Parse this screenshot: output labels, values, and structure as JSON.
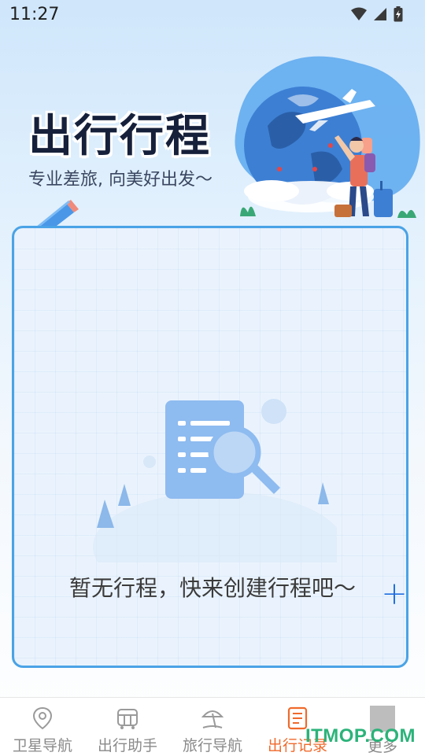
{
  "status_bar": {
    "time": "11:27"
  },
  "hero": {
    "title": "出行行程",
    "subtitle": "专业差旅, 向美好出发～"
  },
  "empty_state": {
    "message": "暂无行程，快来创建行程吧～",
    "add_label": "+"
  },
  "bottom_nav": {
    "items": [
      {
        "label": "卫星导航",
        "icon": "map-pin-icon"
      },
      {
        "label": "出行助手",
        "icon": "bus-icon"
      },
      {
        "label": "旅行导航",
        "icon": "beach-umbrella-icon"
      },
      {
        "label": "出行记录",
        "icon": "notebook-icon",
        "active": true
      },
      {
        "label": "更多",
        "icon": "more-icon"
      }
    ]
  },
  "watermark": "ITMOP.COM",
  "colors": {
    "accent": "#f06a2b",
    "card_border": "#4aa3e6",
    "add_button": "#1f6fe0"
  }
}
